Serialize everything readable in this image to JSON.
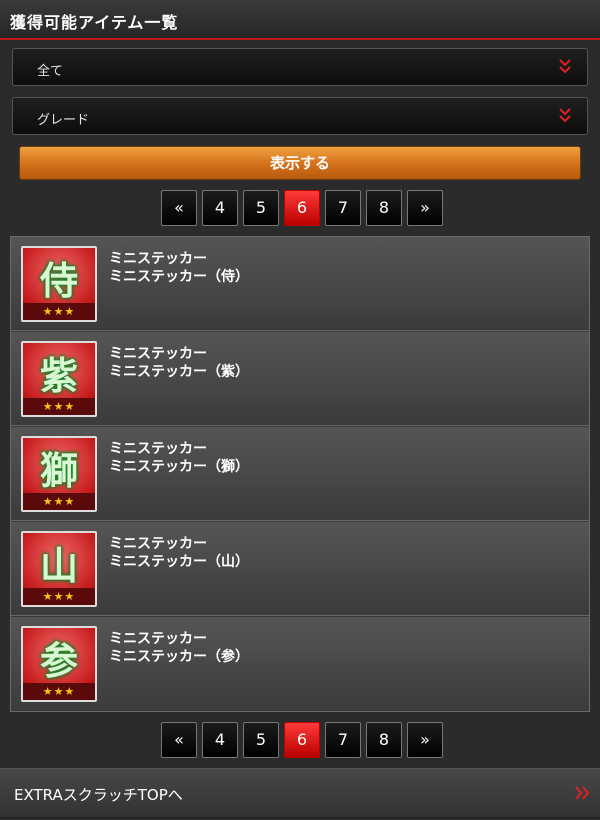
{
  "header": {
    "title": "獲得可能アイテム一覧"
  },
  "filters": {
    "category_value": "全て",
    "grade_value": "グレード"
  },
  "show_button": {
    "label": "表示する"
  },
  "pagination": {
    "first": "«",
    "last": "»",
    "pages": [
      "4",
      "5",
      "6",
      "7",
      "8"
    ],
    "current": "6"
  },
  "items": [
    {
      "kanji": "侍",
      "stars": "★★★",
      "type": "ミニステッカー",
      "name": "ミニステッカー（侍）"
    },
    {
      "kanji": "紫",
      "stars": "★★★",
      "type": "ミニステッカー",
      "name": "ミニステッカー（紫）"
    },
    {
      "kanji": "獅",
      "stars": "★★★",
      "type": "ミニステッカー",
      "name": "ミニステッカー（獅）"
    },
    {
      "kanji": "山",
      "stars": "★★★",
      "type": "ミニステッカー",
      "name": "ミニステッカー（山）"
    },
    {
      "kanji": "参",
      "stars": "★★★",
      "type": "ミニステッカー",
      "name": "ミニステッカー（参）"
    }
  ],
  "footer": {
    "link_label": "EXTRAスクラッチTOPへ"
  },
  "icons": {
    "dropdown": "double-chevron-down-icon",
    "footer_arrow": "double-chevron-right-icon"
  },
  "colors": {
    "accent_red": "#c01818",
    "button_orange": "#d3701a",
    "active_page": "#e01010"
  }
}
